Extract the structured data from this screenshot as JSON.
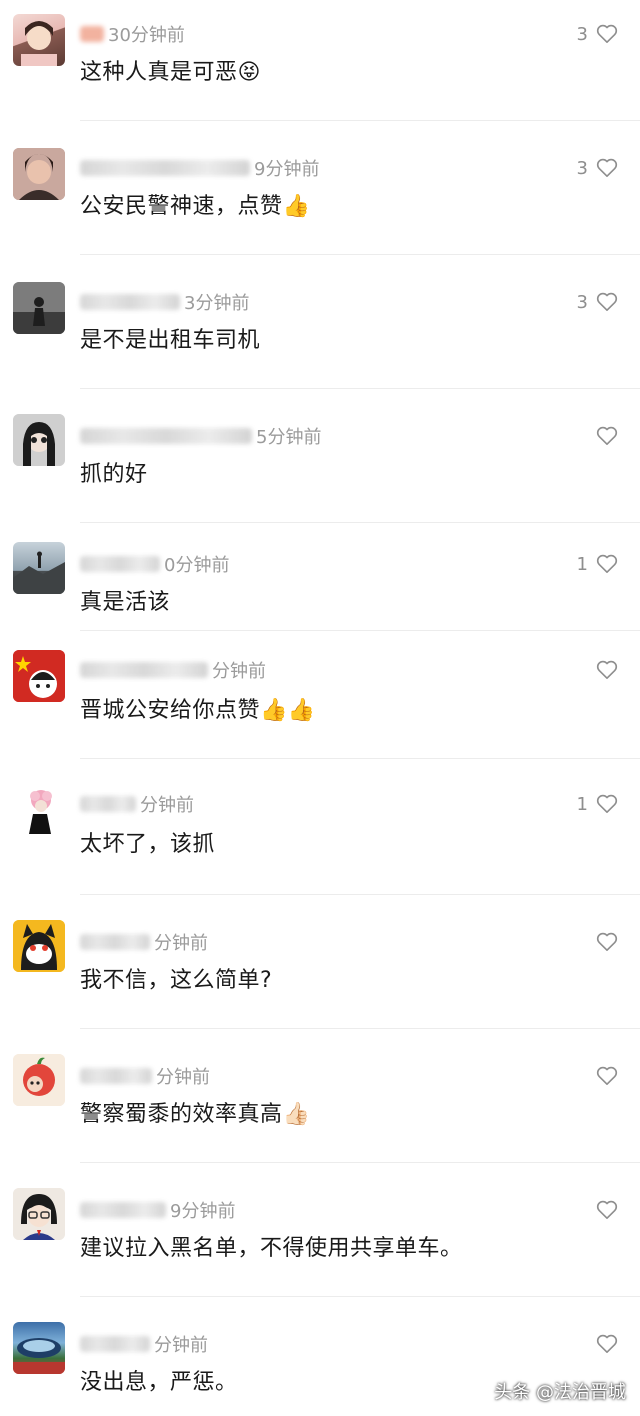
{
  "comments": [
    {
      "time": "30分钟前",
      "text": "这种人真是可恶😝",
      "likes": "3",
      "name_width": 24
    },
    {
      "time": "9分钟前",
      "text": "公安民警神速，点赞👍",
      "likes": "3",
      "name_width": 170
    },
    {
      "time": "3分钟前",
      "text": "是不是出租车司机",
      "likes": "3",
      "name_width": 100
    },
    {
      "time": "5分钟前",
      "text": "抓的好",
      "likes": "",
      "name_width": 172
    },
    {
      "time": "0分钟前",
      "text": "真是活该",
      "likes": "1",
      "name_width": 80
    },
    {
      "time": "分钟前",
      "text": "晋城公安给你点赞👍👍",
      "likes": "",
      "name_width": 128
    },
    {
      "time": "分钟前",
      "text": "太坏了，该抓",
      "likes": "1",
      "name_width": 56
    },
    {
      "time": "分钟前",
      "text": "我不信，这么简单?",
      "likes": "",
      "name_width": 70
    },
    {
      "time": "分钟前",
      "text": "警察蜀黍的效率真高👍🏻",
      "likes": "",
      "name_width": 72
    },
    {
      "time": "9分钟前",
      "text": "建议拉入黑名单，不得使用共享单车。",
      "likes": "",
      "name_width": 86
    },
    {
      "time": "分钟前",
      "text": "没出息，严惩。",
      "likes": "",
      "name_width": 70
    }
  ],
  "watermark": "头条 @法治晋城",
  "colors": {
    "text": "#1a1a1a",
    "meta": "#9b9b9b",
    "divider": "#ececec"
  },
  "icons": {
    "like": "heart-outline-icon"
  }
}
